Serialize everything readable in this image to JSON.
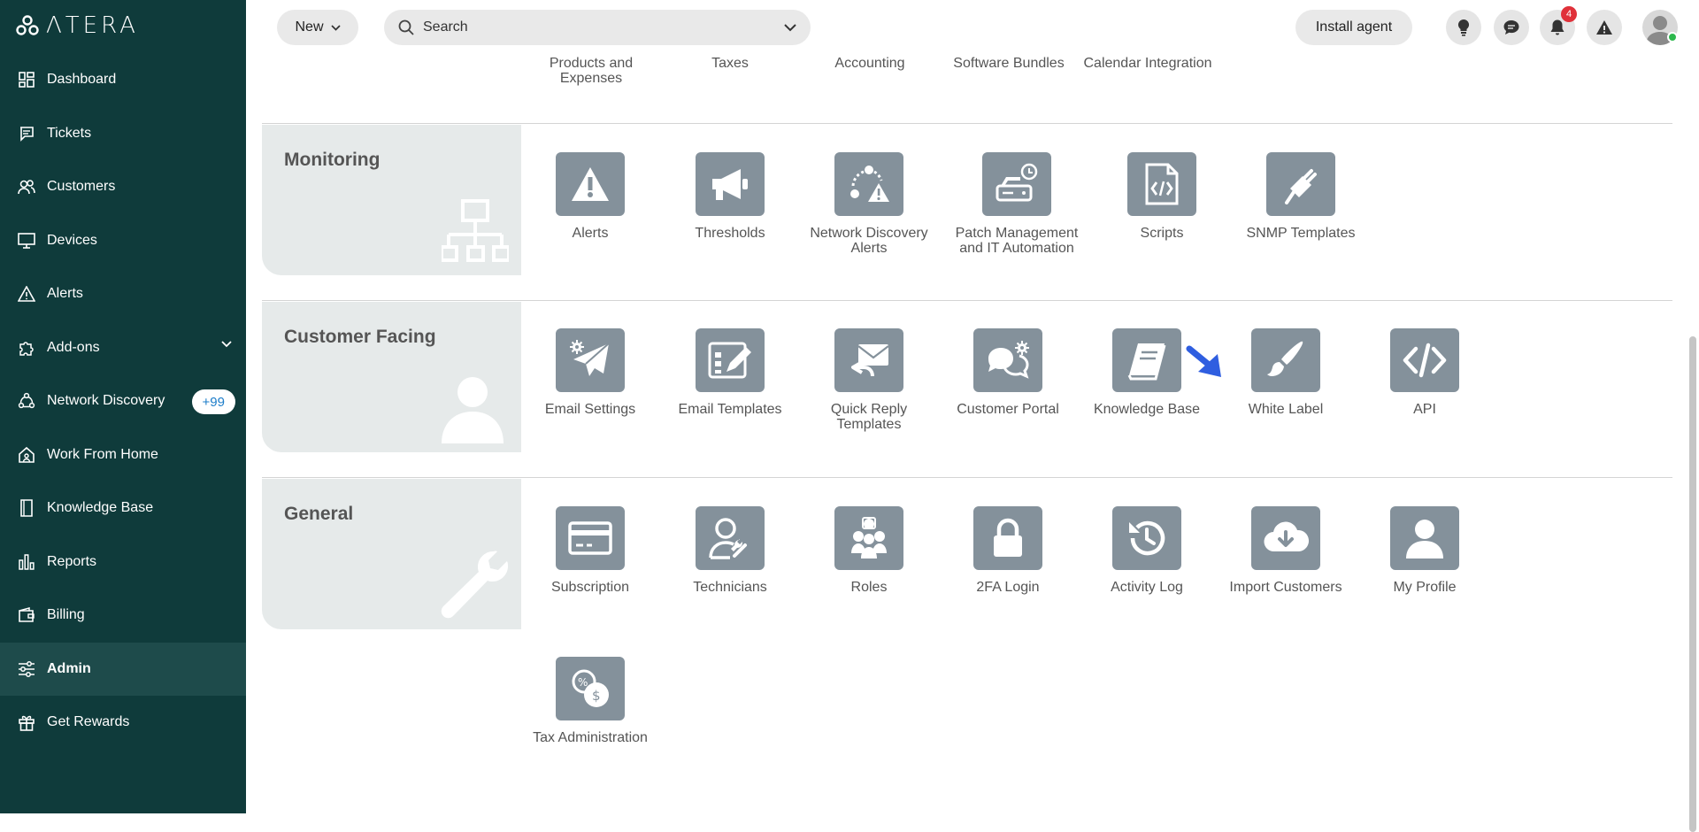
{
  "app": {
    "logo_text": "ΛTERA"
  },
  "sidebar": {
    "items": [
      {
        "label": "Dashboard",
        "icon": "dashboard-icon"
      },
      {
        "label": "Tickets",
        "icon": "tickets-icon"
      },
      {
        "label": "Customers",
        "icon": "customers-icon"
      },
      {
        "label": "Devices",
        "icon": "devices-icon"
      },
      {
        "label": "Alerts",
        "icon": "alerts-icon"
      },
      {
        "label": "Add-ons",
        "icon": "puzzle-icon"
      },
      {
        "label": "Network Discovery",
        "icon": "network-icon",
        "badge": "+99"
      },
      {
        "label": "Work From Home",
        "icon": "home-icon"
      },
      {
        "label": "Knowledge Base",
        "icon": "book-icon"
      },
      {
        "label": "Reports",
        "icon": "reports-icon"
      },
      {
        "label": "Billing",
        "icon": "wallet-icon"
      },
      {
        "label": "Admin",
        "icon": "sliders-icon",
        "active": true
      },
      {
        "label": "Get Rewards",
        "icon": "gift-icon"
      }
    ]
  },
  "topbar": {
    "new_label": "New",
    "search_placeholder": "Search",
    "install_label": "Install agent",
    "notification_count": "4"
  },
  "top_row": [
    "Products and Expenses",
    "Taxes",
    "Accounting",
    "Software Bundles",
    "Calendar Integration"
  ],
  "sections": [
    {
      "title": "Monitoring",
      "tiles": [
        {
          "label": "Alerts",
          "icon": "alert-triangle-icon"
        },
        {
          "label": "Thresholds",
          "icon": "megaphone-icon"
        },
        {
          "label": "Network Discovery Alerts",
          "icon": "network-alert-icon"
        },
        {
          "label": "Patch Management and IT Automation",
          "icon": "patch-drive-icon"
        },
        {
          "label": "Scripts",
          "icon": "script-file-icon"
        },
        {
          "label": "SNMP Templates",
          "icon": "plug-icon"
        }
      ]
    },
    {
      "title": "Customer Facing",
      "tiles": [
        {
          "label": "Email Settings",
          "icon": "email-settings-icon"
        },
        {
          "label": "Email Templates",
          "icon": "email-templates-icon"
        },
        {
          "label": "Quick Reply Templates",
          "icon": "quick-reply-icon"
        },
        {
          "label": "Customer Portal",
          "icon": "customer-portal-icon"
        },
        {
          "label": "Knowledge Base",
          "icon": "knowledge-book-icon"
        },
        {
          "label": "White Label",
          "icon": "brush-icon"
        },
        {
          "label": "API",
          "icon": "code-icon"
        }
      ]
    },
    {
      "title": "General",
      "tiles": [
        {
          "label": "Subscription",
          "icon": "credit-card-icon"
        },
        {
          "label": "Technicians",
          "icon": "technician-icon"
        },
        {
          "label": "Roles",
          "icon": "roles-icon"
        },
        {
          "label": "2FA Login",
          "icon": "lock-icon"
        },
        {
          "label": "Activity Log",
          "icon": "history-icon"
        },
        {
          "label": "Import Customers",
          "icon": "cloud-download-icon"
        },
        {
          "label": "My Profile",
          "icon": "profile-icon"
        },
        {
          "label": "Tax Administration",
          "icon": "tax-icon"
        }
      ]
    }
  ]
}
